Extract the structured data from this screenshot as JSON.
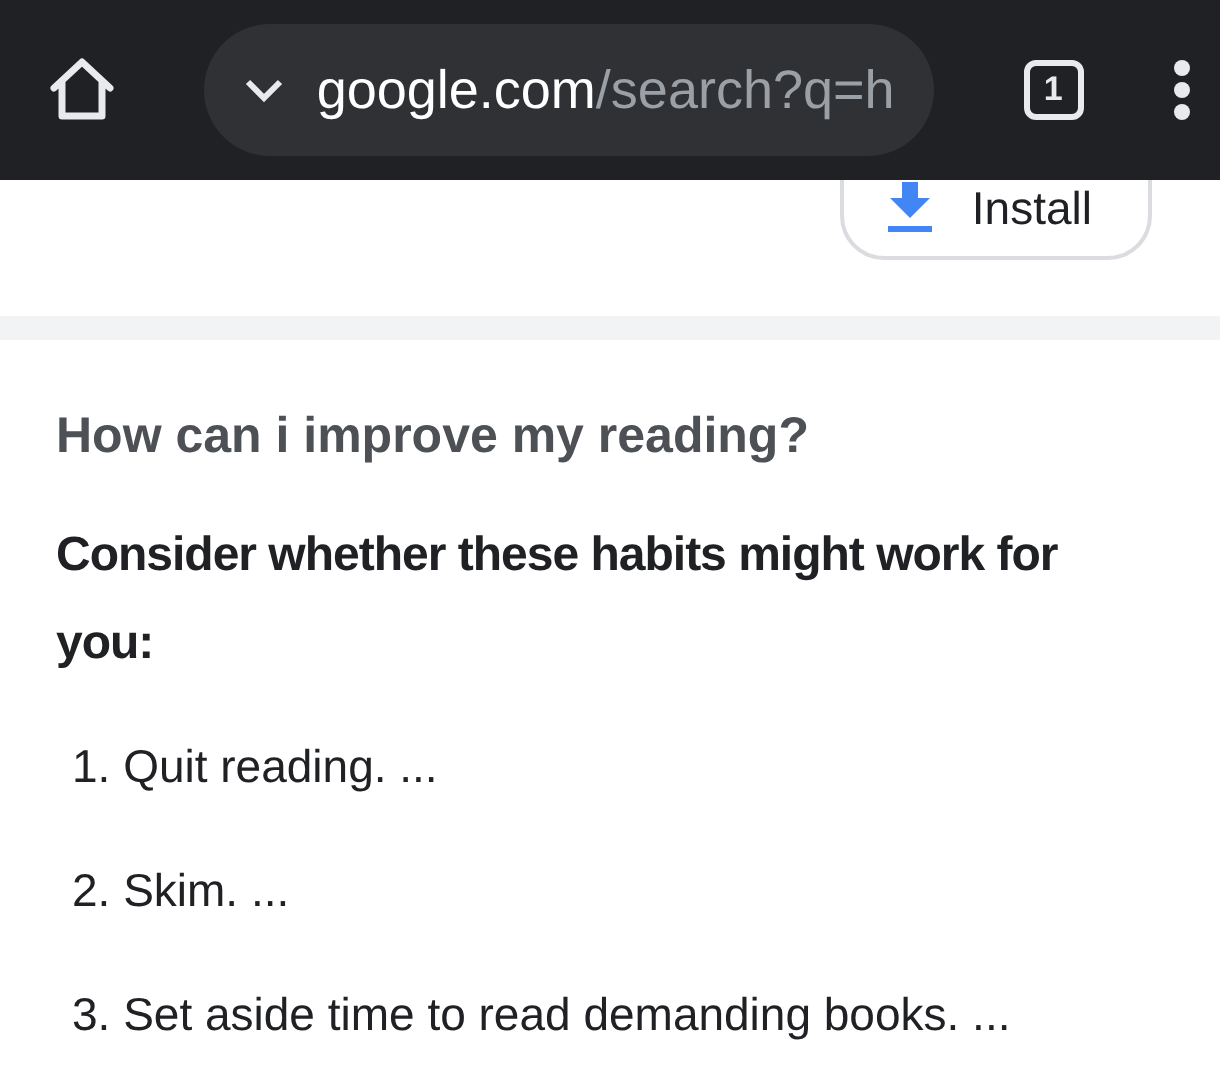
{
  "toolbar": {
    "url_domain": "google.com",
    "url_path": "/search?q=h",
    "tab_count": "1"
  },
  "install_button": {
    "label": "Install"
  },
  "question": "How can i improve my reading?",
  "answer_heading": "Consider whether these habits might work for you:",
  "list_items": [
    {
      "number": "1.",
      "text": "Quit reading. ..."
    },
    {
      "number": "2.",
      "text": "Skim. ..."
    },
    {
      "number": "3.",
      "text": "Set aside time to read demanding books. ..."
    }
  ]
}
